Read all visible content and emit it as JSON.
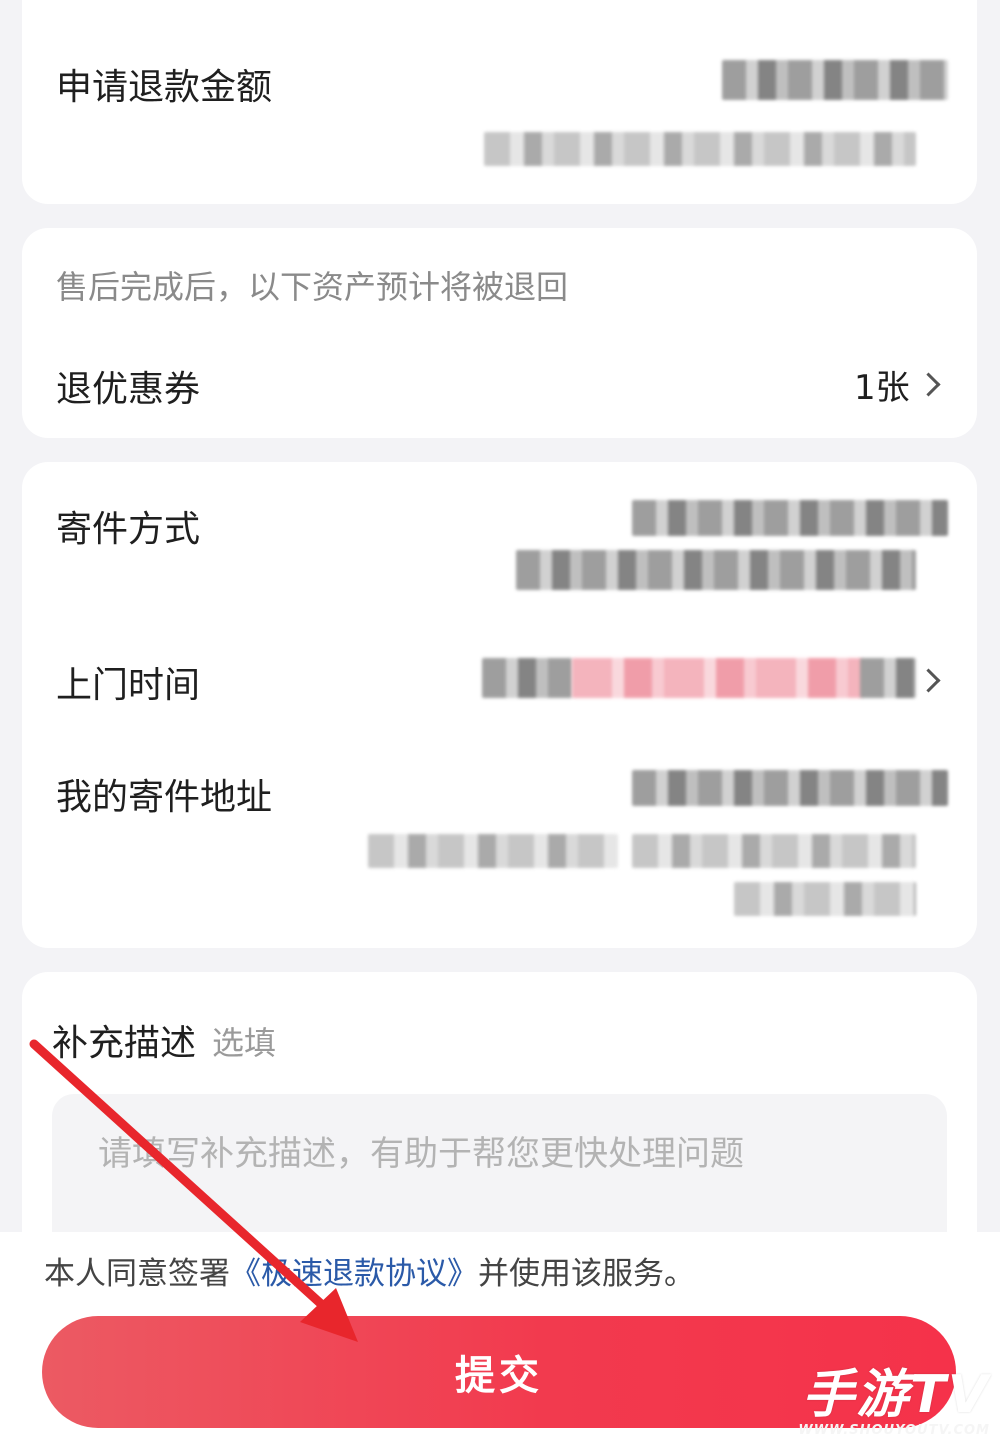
{
  "refund_card": {
    "amount_label": "申请退款金额"
  },
  "assets_card": {
    "notice": "售后完成后，以下资产预计将被退回",
    "coupon_label": "退优惠券",
    "coupon_value": "1张"
  },
  "shipping_card": {
    "method_label": "寄件方式",
    "pickup_time_label": "上门时间",
    "address_label": "我的寄件地址"
  },
  "description_card": {
    "title": "补充描述",
    "optional_hint": "选填",
    "placeholder": "请填写补充描述，有助于帮您更快处理问题"
  },
  "footer": {
    "agree_prefix": "本人同意签署",
    "agree_link": "《极速退款协议》",
    "agree_suffix": "并使用该服务。",
    "submit_label": "提交"
  },
  "watermark": {
    "brand": "手游TV",
    "url": "WWW.SHOUYOUTV.COM"
  },
  "colors": {
    "accent": "#f23a4e",
    "link": "#2b5aa8",
    "annotation_arrow": "#e8262c"
  },
  "icons": [
    "chevron-right-icon",
    "annotation-arrow"
  ]
}
